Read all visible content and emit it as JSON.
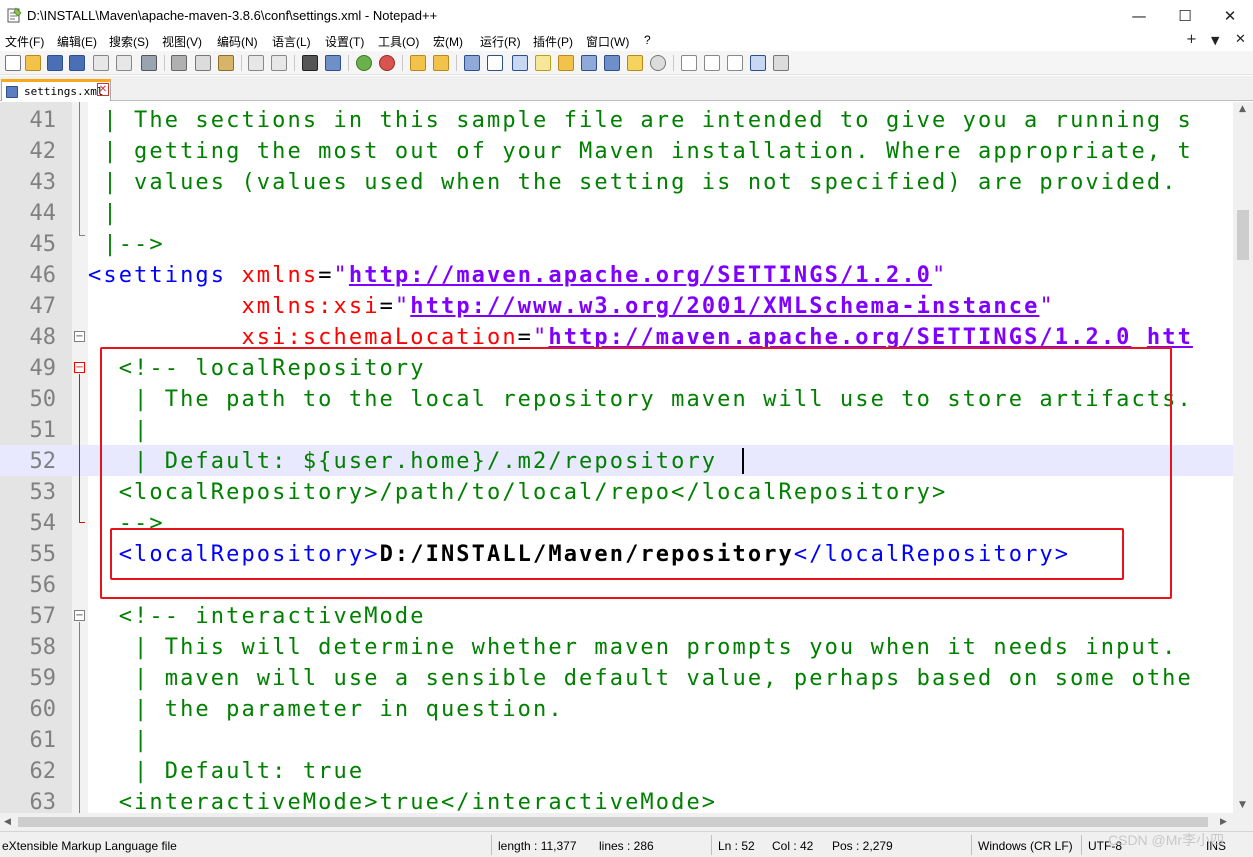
{
  "window": {
    "title": "D:\\INSTALL\\Maven\\apache-maven-3.8.6\\conf\\settings.xml - Notepad++",
    "minimize_icon": "minimize-icon",
    "maximize_icon": "maximize-icon",
    "close_icon": "close-icon",
    "minimize_glyph": "—",
    "maximize_glyph": "☐",
    "close_glyph": "✕"
  },
  "menu": {
    "items": [
      "文件(F)",
      "编辑(E)",
      "搜索(S)",
      "视图(V)",
      "编码(N)",
      "语言(L)",
      "设置(T)",
      "工具(O)",
      "宏(M)",
      "运行(R)",
      "插件(P)",
      "窗口(W)",
      "?"
    ],
    "right": [
      "+",
      "▼",
      "✕"
    ]
  },
  "tab": {
    "label": "settings.xml",
    "close_glyph": "✕"
  },
  "editor": {
    "lines": [
      {
        "n": "41",
        "tokens": [
          {
            "t": " | The sections in this sample file are intended to give you a running s",
            "c": "c-comment"
          }
        ]
      },
      {
        "n": "42",
        "tokens": [
          {
            "t": " | getting the most out of your Maven installation. Where appropriate, t",
            "c": "c-comment"
          }
        ]
      },
      {
        "n": "43",
        "tokens": [
          {
            "t": " | values (values used when the setting is not specified) are provided.",
            "c": "c-comment"
          }
        ]
      },
      {
        "n": "44",
        "tokens": [
          {
            "t": " |",
            "c": "c-comment"
          }
        ]
      },
      {
        "n": "45",
        "tokens": [
          {
            "t": " |-->",
            "c": "c-comment"
          }
        ]
      },
      {
        "n": "46",
        "tokens": [
          {
            "t": "<settings ",
            "c": "c-tag"
          },
          {
            "t": "xmlns",
            "c": "c-attr"
          },
          {
            "t": "=",
            "c": "c-plain"
          },
          {
            "t": "\"",
            "c": "c-q"
          },
          {
            "t": "http://maven.apache.org/SETTINGS/1.2.0",
            "c": "c-val"
          },
          {
            "t": "\"",
            "c": "c-q"
          }
        ]
      },
      {
        "n": "47",
        "tokens": [
          {
            "t": "          ",
            "c": "c-plain"
          },
          {
            "t": "xmlns:xsi",
            "c": "c-attr"
          },
          {
            "t": "=",
            "c": "c-plain"
          },
          {
            "t": "\"",
            "c": "c-q"
          },
          {
            "t": "http://www.w3.org/2001/XMLSchema-instance",
            "c": "c-val"
          },
          {
            "t": "\"",
            "c": "c-q"
          }
        ]
      },
      {
        "n": "48",
        "tokens": [
          {
            "t": "          ",
            "c": "c-plain"
          },
          {
            "t": "xsi:schemaLocation",
            "c": "c-attr"
          },
          {
            "t": "=",
            "c": "c-plain"
          },
          {
            "t": "\"",
            "c": "c-q"
          },
          {
            "t": "http://maven.apache.org/SETTINGS/1.2.0",
            "c": "c-val"
          },
          {
            "t": " ",
            "c": "c-plain"
          },
          {
            "t": "htt",
            "c": "c-val"
          }
        ]
      },
      {
        "n": "49",
        "tokens": [
          {
            "t": "  <!-- localRepository",
            "c": "c-comment"
          }
        ]
      },
      {
        "n": "50",
        "tokens": [
          {
            "t": "   | The path to the local repository maven will use to store artifacts.",
            "c": "c-comment"
          }
        ]
      },
      {
        "n": "51",
        "tokens": [
          {
            "t": "   |",
            "c": "c-comment"
          }
        ]
      },
      {
        "n": "52",
        "tokens": [
          {
            "t": "   | Default: ${user.home}/.m2/repository",
            "c": "c-comment"
          }
        ]
      },
      {
        "n": "53",
        "tokens": [
          {
            "t": "  <localRepository>/path/to/local/repo</localRepository>",
            "c": "c-comment"
          }
        ]
      },
      {
        "n": "54",
        "tokens": [
          {
            "t": "  -->",
            "c": "c-comment"
          }
        ]
      },
      {
        "n": "55",
        "tokens": [
          {
            "t": "  <localRepository>",
            "c": "c-tag"
          },
          {
            "t": "D:/INSTALL/Maven/repository",
            "c": "c-text"
          },
          {
            "t": "</localRepository>",
            "c": "c-tag"
          }
        ]
      },
      {
        "n": "56",
        "tokens": []
      },
      {
        "n": "57",
        "tokens": [
          {
            "t": "  <!-- interactiveMode",
            "c": "c-comment"
          }
        ]
      },
      {
        "n": "58",
        "tokens": [
          {
            "t": "   | This will determine whether maven prompts you when it needs input.",
            "c": "c-comment"
          }
        ]
      },
      {
        "n": "59",
        "tokens": [
          {
            "t": "   | maven will use a sensible default value, perhaps based on some othe",
            "c": "c-comment"
          }
        ]
      },
      {
        "n": "60",
        "tokens": [
          {
            "t": "   | the parameter in question.",
            "c": "c-comment"
          }
        ]
      },
      {
        "n": "61",
        "tokens": [
          {
            "t": "   |",
            "c": "c-comment"
          }
        ]
      },
      {
        "n": "62",
        "tokens": [
          {
            "t": "   | Default: true",
            "c": "c-comment"
          }
        ]
      },
      {
        "n": "63",
        "tokens": [
          {
            "t": "  <interactiveMode>true</interactiveMode>",
            "c": "c-comment"
          }
        ]
      }
    ],
    "current_line": "52"
  },
  "status": {
    "filetype": "eXtensible Markup Language file",
    "length": "length : 11,377",
    "lines": "lines : 286",
    "ln": "Ln : 52",
    "col": "Col : 42",
    "pos": "Pos : 2,279",
    "eol": "Windows (CR LF)",
    "encoding": "UTF-8",
    "mode": "INS",
    "watermark": "CSDN @Mr李小四"
  }
}
